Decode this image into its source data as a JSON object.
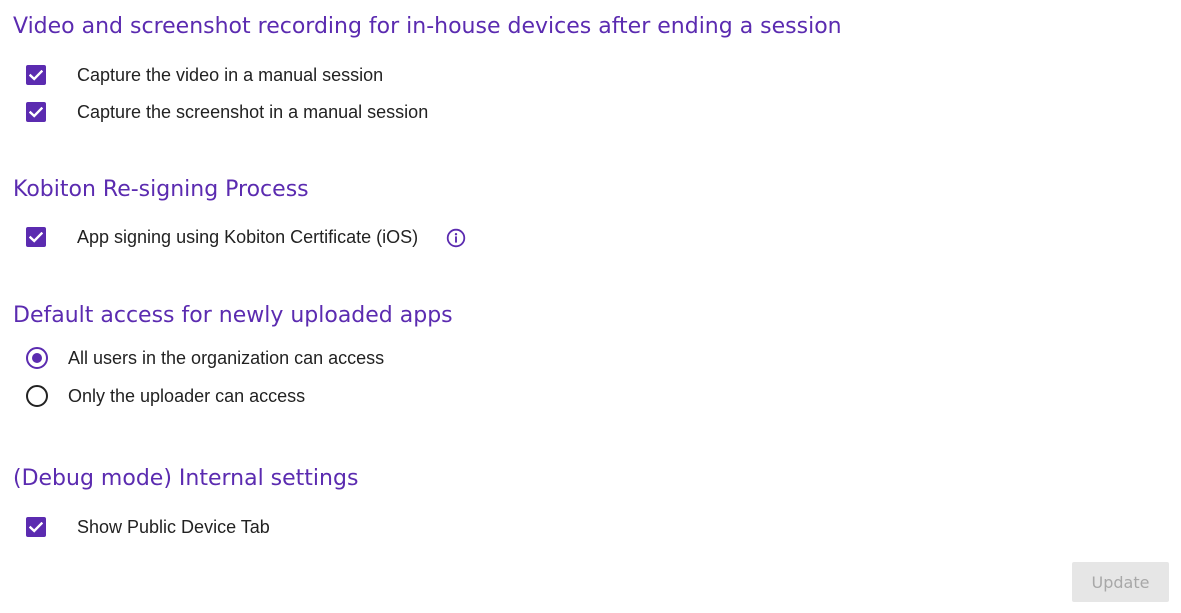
{
  "colors": {
    "accent": "#5b2bb0",
    "text": "#222222",
    "button_disabled_bg": "#e6e6e6",
    "button_disabled_text": "#a8a8a8"
  },
  "recording": {
    "title": "Video and screenshot recording for in-house devices after ending a session",
    "options": [
      {
        "label": "Capture the video in a manual session",
        "checked": true
      },
      {
        "label": "Capture the screenshot in a manual session",
        "checked": true
      }
    ]
  },
  "resigning": {
    "title": "Kobiton Re-signing Process",
    "options": [
      {
        "label": "App signing using Kobiton Certificate (iOS)",
        "checked": true,
        "icon": "info-icon"
      }
    ]
  },
  "access": {
    "title": "Default access for newly uploaded apps",
    "options": [
      {
        "label": "All users in the organization can access",
        "selected": true
      },
      {
        "label": "Only the uploader can access",
        "selected": false
      }
    ]
  },
  "debug": {
    "title": "(Debug mode) Internal settings",
    "options": [
      {
        "label": "Show Public Device Tab",
        "checked": true
      }
    ]
  },
  "actions": {
    "update_label": "Update",
    "update_enabled": false
  }
}
